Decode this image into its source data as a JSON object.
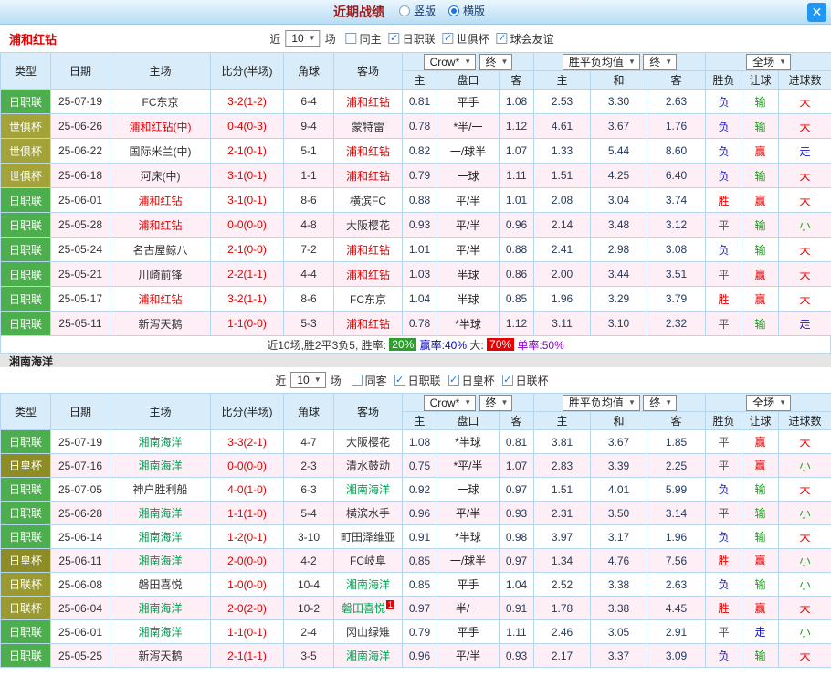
{
  "topbar": {
    "title": "近期战绩",
    "radios": [
      {
        "label": "竖版",
        "selected": false
      },
      {
        "label": "横版",
        "selected": true
      }
    ],
    "close_label": "✕"
  },
  "sections": [
    {
      "team": "浦和红钻",
      "team_title_color": "#e60000",
      "team_hl_color": "#e60000",
      "filter": {
        "prefix": "近",
        "count": "10",
        "suffix": "场",
        "checkboxes": [
          {
            "label": "同主",
            "checked": false
          },
          {
            "label": "日职联",
            "checked": true
          },
          {
            "label": "世俱杯",
            "checked": true
          },
          {
            "label": "球会友谊",
            "checked": true
          }
        ]
      },
      "header": {
        "cols": [
          "类型",
          "日期",
          "主场",
          "比分(半场)",
          "角球",
          "客场"
        ],
        "asia_dropdown": "Crow*",
        "asia_final": "终",
        "asia_sub": [
          "主",
          "盘口",
          "客"
        ],
        "europe_dropdown": "胜平负均值",
        "europe_final": "终",
        "europe_sub": [
          "主",
          "和",
          "客"
        ],
        "fullmatch_dropdown": "全场",
        "result_sub": [
          "胜负",
          "让球",
          "进球数"
        ]
      },
      "rows": [
        {
          "league": "日职联",
          "league_color": "#4cae4c",
          "date": "25-07-19",
          "home": "FC东京",
          "home_hl": false,
          "score": "3-2(1-2)",
          "corner": "6-4",
          "away": "浦和红钻",
          "away_hl": true,
          "asia_home": "0.81",
          "handicap": "平手",
          "asia_away": "1.08",
          "eu_home": "2.53",
          "eu_draw": "3.30",
          "eu_away": "2.63",
          "result": "负",
          "result_color": "#1414cc",
          "cover": "输",
          "cover_color": "#13a113",
          "goals": "大",
          "goals_color": "#e60000"
        },
        {
          "league": "世俱杯",
          "league_color": "#a3a339",
          "date": "25-06-26",
          "home": "浦和红钻(中)",
          "home_hl": true,
          "score": "0-4(0-3)",
          "corner": "9-4",
          "away": "蒙特雷",
          "away_hl": false,
          "asia_home": "0.78",
          "handicap": "*半/一",
          "asia_away": "1.12",
          "eu_home": "4.61",
          "eu_draw": "3.67",
          "eu_away": "1.76",
          "result": "负",
          "result_color": "#1414cc",
          "cover": "输",
          "cover_color": "#13a113",
          "goals": "大",
          "goals_color": "#e60000"
        },
        {
          "league": "世俱杯",
          "league_color": "#a3a339",
          "date": "25-06-22",
          "home": "国际米兰(中)",
          "home_hl": false,
          "score": "2-1(0-1)",
          "corner": "5-1",
          "away": "浦和红钻",
          "away_hl": true,
          "asia_home": "0.82",
          "handicap": "一/球半",
          "asia_away": "1.07",
          "eu_home": "1.33",
          "eu_draw": "5.44",
          "eu_away": "8.60",
          "result": "负",
          "result_color": "#1414cc",
          "cover": "赢",
          "cover_color": "#e60000",
          "goals": "走",
          "goals_color": "#1414cc"
        },
        {
          "league": "世俱杯",
          "league_color": "#a3a339",
          "date": "25-06-18",
          "home": "河床(中)",
          "home_hl": false,
          "score": "3-1(0-1)",
          "corner": "1-1",
          "away": "浦和红钻",
          "away_hl": true,
          "asia_home": "0.79",
          "handicap": "一球",
          "asia_away": "1.11",
          "eu_home": "1.51",
          "eu_draw": "4.25",
          "eu_away": "6.40",
          "result": "负",
          "result_color": "#1414cc",
          "cover": "输",
          "cover_color": "#13a113",
          "goals": "大",
          "goals_color": "#e60000"
        },
        {
          "league": "日职联",
          "league_color": "#4cae4c",
          "date": "25-06-01",
          "home": "浦和红钻",
          "home_hl": true,
          "score": "3-1(0-1)",
          "corner": "8-6",
          "away": "横滨FC",
          "away_hl": false,
          "asia_home": "0.88",
          "handicap": "平/半",
          "asia_away": "1.01",
          "eu_home": "2.08",
          "eu_draw": "3.04",
          "eu_away": "3.74",
          "result": "胜",
          "result_color": "#e60000",
          "cover": "赢",
          "cover_color": "#e60000",
          "goals": "大",
          "goals_color": "#e60000"
        },
        {
          "league": "日职联",
          "league_color": "#4cae4c",
          "date": "25-05-28",
          "home": "浦和红钻",
          "home_hl": true,
          "score": "0-0(0-0)",
          "corner": "4-8",
          "away": "大阪樱花",
          "away_hl": false,
          "asia_home": "0.93",
          "handicap": "平/半",
          "asia_away": "0.96",
          "eu_home": "2.14",
          "eu_draw": "3.48",
          "eu_away": "3.12",
          "result": "平",
          "result_color": "#555555",
          "cover": "输",
          "cover_color": "#13a113",
          "goals": "小",
          "goals_color": "#13a113"
        },
        {
          "league": "日职联",
          "league_color": "#4cae4c",
          "date": "25-05-24",
          "home": "名古屋鲸八",
          "home_hl": false,
          "score": "2-1(0-0)",
          "corner": "7-2",
          "away": "浦和红钻",
          "away_hl": true,
          "asia_home": "1.01",
          "handicap": "平/半",
          "asia_away": "0.88",
          "eu_home": "2.41",
          "eu_draw": "2.98",
          "eu_away": "3.08",
          "result": "负",
          "result_color": "#1414cc",
          "cover": "输",
          "cover_color": "#13a113",
          "goals": "大",
          "goals_color": "#e60000"
        },
        {
          "league": "日职联",
          "league_color": "#4cae4c",
          "date": "25-05-21",
          "home": "川崎前锋",
          "home_hl": false,
          "score": "2-2(1-1)",
          "corner": "4-4",
          "away": "浦和红钻",
          "away_hl": true,
          "asia_home": "1.03",
          "handicap": "半球",
          "asia_away": "0.86",
          "eu_home": "2.00",
          "eu_draw": "3.44",
          "eu_away": "3.51",
          "result": "平",
          "result_color": "#555555",
          "cover": "赢",
          "cover_color": "#e60000",
          "goals": "大",
          "goals_color": "#e60000"
        },
        {
          "league": "日职联",
          "league_color": "#4cae4c",
          "date": "25-05-17",
          "home": "浦和红钻",
          "home_hl": true,
          "score": "3-2(1-1)",
          "corner": "8-6",
          "away": "FC东京",
          "away_hl": false,
          "asia_home": "1.04",
          "handicap": "半球",
          "asia_away": "0.85",
          "eu_home": "1.96",
          "eu_draw": "3.29",
          "eu_away": "3.79",
          "result": "胜",
          "result_color": "#e60000",
          "cover": "赢",
          "cover_color": "#e60000",
          "goals": "大",
          "goals_color": "#e60000"
        },
        {
          "league": "日职联",
          "league_color": "#4cae4c",
          "date": "25-05-11",
          "home": "新泻天鹅",
          "home_hl": false,
          "score": "1-1(0-0)",
          "corner": "5-3",
          "away": "浦和红钻",
          "away_hl": true,
          "asia_home": "0.78",
          "handicap": "*半球",
          "asia_away": "1.12",
          "eu_home": "3.11",
          "eu_draw": "3.10",
          "eu_away": "2.32",
          "result": "平",
          "result_color": "#555555",
          "cover": "输",
          "cover_color": "#13a113",
          "goals": "走",
          "goals_color": "#1414cc"
        }
      ],
      "summary_segments": [
        {
          "text": "近10场,胜2平3负5, 胜率: ",
          "color": "#333333"
        },
        {
          "text": "20%",
          "color": "#ffffff",
          "bg": "#2e9e2e"
        },
        {
          "text": " ",
          "color": "#333333"
        },
        {
          "text": "赢率:40%",
          "color": "#0000cc"
        },
        {
          "text": " 大: ",
          "color": "#333333"
        },
        {
          "text": "70%",
          "color": "#ffffff",
          "bg": "#e60000"
        },
        {
          "text": " ",
          "color": "#333333"
        },
        {
          "text": "单率:50%",
          "color": "#8800cc"
        }
      ]
    },
    {
      "team": "湘南海洋",
      "team_title_color": "#222222",
      "team_hl_color": "#00a052",
      "filter": {
        "prefix": "近",
        "count": "10",
        "suffix": "场",
        "checkboxes": [
          {
            "label": "同客",
            "checked": false
          },
          {
            "label": "日职联",
            "checked": true
          },
          {
            "label": "日皇杯",
            "checked": true
          },
          {
            "label": "日联杯",
            "checked": true
          }
        ]
      },
      "header": {
        "cols": [
          "类型",
          "日期",
          "主场",
          "比分(半场)",
          "角球",
          "客场"
        ],
        "asia_dropdown": "Crow*",
        "asia_final": "终",
        "asia_sub": [
          "主",
          "盘口",
          "客"
        ],
        "europe_dropdown": "胜平负均值",
        "europe_final": "终",
        "europe_sub": [
          "主",
          "和",
          "客"
        ],
        "fullmatch_dropdown": "全场",
        "result_sub": [
          "胜负",
          "让球",
          "进球数"
        ]
      },
      "rows": [
        {
          "league": "日职联",
          "league_color": "#4cae4c",
          "date": "25-07-19",
          "home": "湘南海洋",
          "home_hl": true,
          "score": "3-3(2-1)",
          "corner": "4-7",
          "away": "大阪樱花",
          "away_hl": false,
          "asia_home": "1.08",
          "handicap": "*半球",
          "asia_away": "0.81",
          "eu_home": "3.81",
          "eu_draw": "3.67",
          "eu_away": "1.85",
          "result": "平",
          "result_color": "#555555",
          "cover": "赢",
          "cover_color": "#e60000",
          "goals": "大",
          "goals_color": "#e60000"
        },
        {
          "league": "日皇杯",
          "league_color": "#8e8c24",
          "date": "25-07-16",
          "home": "湘南海洋",
          "home_hl": true,
          "score": "0-0(0-0)",
          "corner": "2-3",
          "away": "清水鼓动",
          "away_hl": false,
          "asia_home": "0.75",
          "handicap": "*平/半",
          "asia_away": "1.07",
          "eu_home": "2.83",
          "eu_draw": "3.39",
          "eu_away": "2.25",
          "result": "平",
          "result_color": "#555555",
          "cover": "赢",
          "cover_color": "#e60000",
          "goals": "小",
          "goals_color": "#13a113"
        },
        {
          "league": "日职联",
          "league_color": "#4cae4c",
          "date": "25-07-05",
          "home": "神户胜利船",
          "home_hl": false,
          "score": "4-0(1-0)",
          "corner": "6-3",
          "away": "湘南海洋",
          "away_hl": true,
          "asia_home": "0.92",
          "handicap": "一球",
          "asia_away": "0.97",
          "eu_home": "1.51",
          "eu_draw": "4.01",
          "eu_away": "5.99",
          "result": "负",
          "result_color": "#1414cc",
          "cover": "输",
          "cover_color": "#13a113",
          "goals": "大",
          "goals_color": "#e60000"
        },
        {
          "league": "日职联",
          "league_color": "#4cae4c",
          "date": "25-06-28",
          "home": "湘南海洋",
          "home_hl": true,
          "score": "1-1(1-0)",
          "corner": "5-4",
          "away": "横滨水手",
          "away_hl": false,
          "asia_home": "0.96",
          "handicap": "平/半",
          "asia_away": "0.93",
          "eu_home": "2.31",
          "eu_draw": "3.50",
          "eu_away": "3.14",
          "result": "平",
          "result_color": "#555555",
          "cover": "输",
          "cover_color": "#13a113",
          "goals": "小",
          "goals_color": "#13a113"
        },
        {
          "league": "日职联",
          "league_color": "#4cae4c",
          "date": "25-06-14",
          "home": "湘南海洋",
          "home_hl": true,
          "score": "1-2(0-1)",
          "corner": "3-10",
          "away": "町田泽维亚",
          "away_hl": false,
          "asia_home": "0.91",
          "handicap": "*半球",
          "asia_away": "0.98",
          "eu_home": "3.97",
          "eu_draw": "3.17",
          "eu_away": "1.96",
          "result": "负",
          "result_color": "#1414cc",
          "cover": "输",
          "cover_color": "#13a113",
          "goals": "大",
          "goals_color": "#e60000"
        },
        {
          "league": "日皇杯",
          "league_color": "#8e8c24",
          "date": "25-06-11",
          "home": "湘南海洋",
          "home_hl": true,
          "score": "2-0(0-0)",
          "corner": "4-2",
          "away": "FC岐阜",
          "away_hl": false,
          "asia_home": "0.85",
          "handicap": "一/球半",
          "asia_away": "0.97",
          "eu_home": "1.34",
          "eu_draw": "4.76",
          "eu_away": "7.56",
          "result": "胜",
          "result_color": "#e60000",
          "cover": "赢",
          "cover_color": "#e60000",
          "goals": "小",
          "goals_color": "#13a113"
        },
        {
          "league": "日联杯",
          "league_color": "#9a9a30",
          "date": "25-06-08",
          "home": "磐田喜悦",
          "home_hl": false,
          "score": "1-0(0-0)",
          "corner": "10-4",
          "away": "湘南海洋",
          "away_hl": true,
          "asia_home": "0.85",
          "handicap": "平手",
          "asia_away": "1.04",
          "eu_home": "2.52",
          "eu_draw": "3.38",
          "eu_away": "2.63",
          "result": "负",
          "result_color": "#1414cc",
          "cover": "输",
          "cover_color": "#13a113",
          "goals": "小",
          "goals_color": "#13a113"
        },
        {
          "league": "日联杯",
          "league_color": "#9a9a30",
          "date": "25-06-04",
          "home": "湘南海洋",
          "home_hl": true,
          "score": "2-0(2-0)",
          "corner": "10-2",
          "away": "磐田喜悦",
          "away_hl": true,
          "away_badge": "1",
          "asia_home": "0.97",
          "handicap": "半/一",
          "asia_away": "0.91",
          "eu_home": "1.78",
          "eu_draw": "3.38",
          "eu_away": "4.45",
          "result": "胜",
          "result_color": "#e60000",
          "cover": "赢",
          "cover_color": "#e60000",
          "goals": "大",
          "goals_color": "#e60000"
        },
        {
          "league": "日职联",
          "league_color": "#4cae4c",
          "date": "25-06-01",
          "home": "湘南海洋",
          "home_hl": true,
          "score": "1-1(0-1)",
          "corner": "2-4",
          "away": "冈山绿雉",
          "away_hl": false,
          "asia_home": "0.79",
          "handicap": "平手",
          "asia_away": "1.11",
          "eu_home": "2.46",
          "eu_draw": "3.05",
          "eu_away": "2.91",
          "result": "平",
          "result_color": "#555555",
          "cover": "走",
          "cover_color": "#1414cc",
          "goals": "小",
          "goals_color": "#13a113"
        },
        {
          "league": "日职联",
          "league_color": "#4cae4c",
          "date": "25-05-25",
          "home": "新泻天鹅",
          "home_hl": false,
          "score": "2-1(1-1)",
          "corner": "3-5",
          "away": "湘南海洋",
          "away_hl": true,
          "asia_home": "0.96",
          "handicap": "平/半",
          "asia_away": "0.93",
          "eu_home": "2.17",
          "eu_draw": "3.37",
          "eu_away": "3.09",
          "result": "负",
          "result_color": "#1414cc",
          "cover": "输",
          "cover_color": "#13a113",
          "goals": "大",
          "goals_color": "#e60000"
        }
      ]
    }
  ]
}
